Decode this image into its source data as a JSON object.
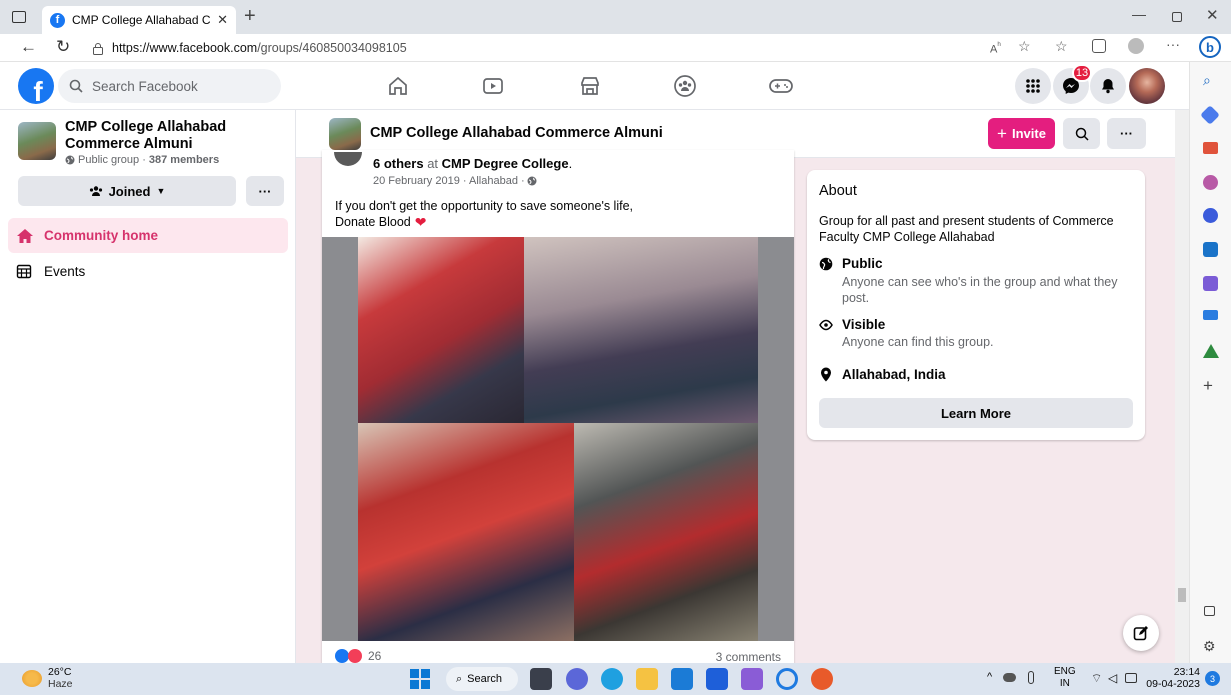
{
  "browser": {
    "tab_title": "CMP College Allahabad Comme",
    "url_host": "https://www.facebook.com",
    "url_path": "/groups/460850034098105"
  },
  "fb": {
    "search_placeholder": "Search Facebook",
    "messenger_badge": "13"
  },
  "sidebar": {
    "group_name": "CMP College Allahabad Commerce Almuni",
    "group_meta_prefix": "Public group · ",
    "group_members": "387 members",
    "joined_label": "Joined",
    "more_label": "···",
    "nav": [
      {
        "label": "Community home"
      },
      {
        "label": "Events"
      }
    ]
  },
  "group_header": {
    "title": "CMP College Allahabad Commerce Almuni",
    "invite_label": "Invite",
    "more_label": "···"
  },
  "post": {
    "tag_others": "6 others",
    "tag_at": " at ",
    "tag_place": "CMP Degree College",
    "tag_end": ".",
    "date": "20 February 2019 · Allahabad · ",
    "text_line1": "If you don't get the opportunity to save someone's life,",
    "text_line2": "Donate Blood",
    "reactions_count": "26",
    "comments": "3 comments"
  },
  "about": {
    "title": "About",
    "description": "Group for all past and present students of Commerce Faculty CMP College Allahabad",
    "items": [
      {
        "title": "Public",
        "desc": "Anyone can see who's in the group and what they post."
      },
      {
        "title": "Visible",
        "desc": "Anyone can find this group."
      },
      {
        "title": "Allahabad, India",
        "desc": ""
      }
    ],
    "learn_more": "Learn More"
  },
  "taskbar": {
    "temp": "26°C",
    "weather": "Haze",
    "search_label": "Search",
    "lang_top": "ENG",
    "lang_bottom": "IN",
    "time": "23:14",
    "date": "09-04-2023",
    "notif_count": "3"
  },
  "colors": {
    "fb_blue": "#1877f2",
    "invite_pink": "#e41e7f",
    "community_pink": "#d6336c"
  }
}
